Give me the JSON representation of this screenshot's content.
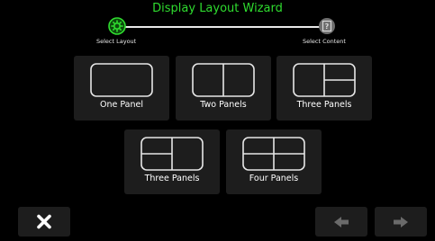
{
  "wizard": {
    "title": "Display Layout Wizard",
    "steps": [
      {
        "label": "Select Layout",
        "state": "active",
        "icon": "gear-icon"
      },
      {
        "label": "Select Content",
        "state": "pending",
        "icon": "help-icon"
      }
    ],
    "accent_color": "#2fdc2f"
  },
  "layouts": [
    {
      "label": "One Panel",
      "icon": "one-panel-layout-icon"
    },
    {
      "label": "Two Panels",
      "icon": "two-panels-layout-icon"
    },
    {
      "label": "Three Panels",
      "icon": "three-panels-right-split-layout-icon"
    },
    {
      "label": "Three Panels",
      "icon": "three-panels-left-split-layout-icon"
    },
    {
      "label": "Four Panels",
      "icon": "four-panels-layout-icon"
    }
  ],
  "footer": {
    "close_icon": "close-icon",
    "back_icon": "arrow-left-icon",
    "next_icon": "arrow-right-icon"
  }
}
